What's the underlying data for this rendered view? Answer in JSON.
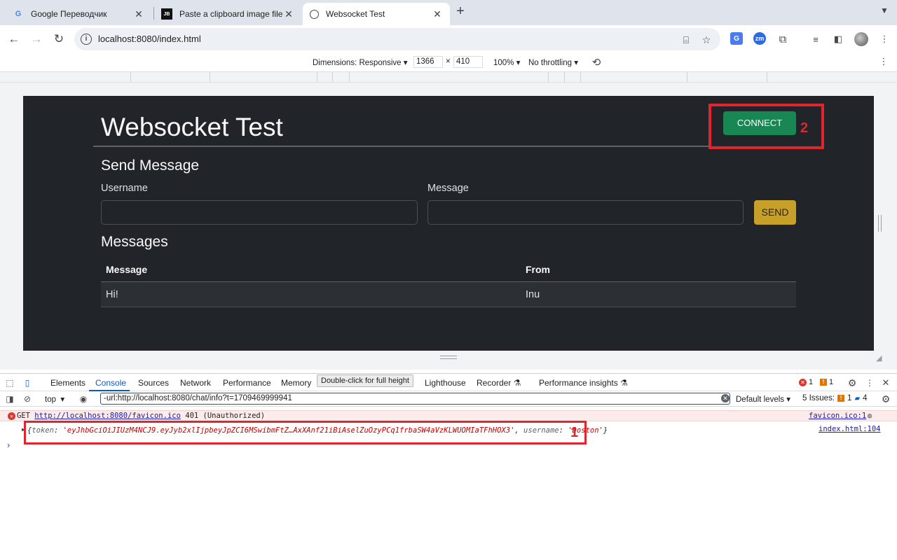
{
  "browser": {
    "tabs": [
      {
        "title": "Google Переводчик",
        "icon": "google-translate-icon",
        "active": false
      },
      {
        "title": "Paste a clipboard image file i",
        "icon": "jetbrains-icon",
        "active": false
      },
      {
        "title": "Websocket Test",
        "icon": "globe-icon",
        "active": true
      }
    ],
    "url": "localhost:8080/index.html"
  },
  "device_toolbar": {
    "dimensions_label": "Dimensions: Responsive",
    "width": "1366",
    "times": "×",
    "height": "410",
    "zoom": "100%",
    "throttling": "No throttling"
  },
  "app": {
    "title": "Websocket Test",
    "connect_label": "CONNECT",
    "send_heading": "Send Message",
    "username_label": "Username",
    "message_label": "Message",
    "send_label": "SEND",
    "messages_heading": "Messages",
    "table": {
      "headers": [
        "Message",
        "From"
      ],
      "rows": [
        [
          "Hi!",
          "Inu"
        ]
      ]
    }
  },
  "annotations": {
    "box1_number": "1",
    "box2_number": "2",
    "color": "#e0262c"
  },
  "devtools": {
    "tabs": [
      "Elements",
      "Console",
      "Sources",
      "Network",
      "Performance",
      "Memory",
      "Lighthouse",
      "Recorder",
      "Performance insights"
    ],
    "active_tab": "Console",
    "tooltip": "Double-click for full height",
    "error_count": "1",
    "warning_count": "1",
    "context": "top",
    "filter_value": "-url:http://localhost:8080/chat/info?t=1709469999941",
    "levels": "Default levels",
    "issues_label": "5 Issues:",
    "issues_warn": "1",
    "issues_info": "4",
    "console": {
      "error_method": "GET",
      "error_url": "http://localhost:8080/favicon.ico",
      "error_status": "401 (Unauthorized)",
      "error_source": "favicon.ico:1",
      "obj_open": "{",
      "obj_key1": "token",
      "obj_val1": "'eyJhbGciOiJIUzM4NCJ9.eyJyb2xlIjpbeyJpZCI6MSwibmFtZ…AxXAnf21iBiAselZuOzyPCq1frbaSW4aVzKLWUOMIaTFhHOX3'",
      "obj_key2": "username",
      "obj_val2": "'Doston'",
      "obj_close": "}",
      "obj_source": "index.html:104"
    }
  }
}
